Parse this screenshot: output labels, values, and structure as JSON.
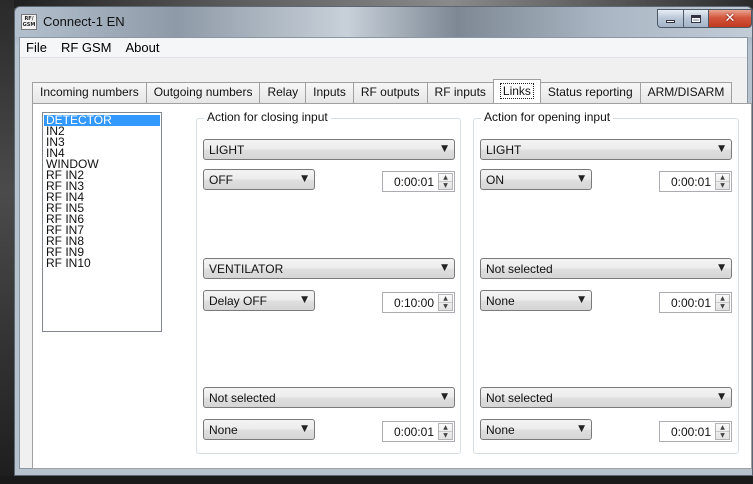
{
  "window": {
    "title": "Connect-1 EN",
    "icon_text": "RF/ GSM",
    "controls": {
      "minimize_icon": "minimize-icon",
      "maximize_icon": "maximize-icon",
      "close_icon": "close-icon",
      "close_glyph": "✕"
    }
  },
  "menu": [
    "File",
    "RF GSM",
    "About"
  ],
  "tabs": [
    {
      "label": "Incoming numbers"
    },
    {
      "label": "Outgoing numbers"
    },
    {
      "label": "Relay"
    },
    {
      "label": "Inputs"
    },
    {
      "label": "RF outputs"
    },
    {
      "label": "RF inputs"
    },
    {
      "label": "Links",
      "active": true
    },
    {
      "label": "Status reporting"
    },
    {
      "label": "ARM/DISARM"
    }
  ],
  "inputs_list": {
    "selected": "DETECTOR",
    "items": [
      "DETECTOR",
      "IN2",
      "IN3",
      "IN4",
      "WINDOW",
      "RF IN2",
      "RF IN3",
      "RF IN4",
      "RF IN5",
      "RF IN6",
      "RF IN7",
      "RF IN8",
      "RF IN9",
      "RF IN10"
    ]
  },
  "closing": {
    "title": "Action for closing input",
    "rows": [
      {
        "target": "LIGHT",
        "action": "OFF",
        "time": "0:00:01"
      },
      {
        "target": "VENTILATOR",
        "action": "Delay OFF",
        "time": "0:10:00"
      },
      {
        "target": "Not selected",
        "action": "None",
        "time": "0:00:01"
      }
    ]
  },
  "opening": {
    "title": "Action for opening input",
    "rows": [
      {
        "target": "LIGHT",
        "action": "ON",
        "time": "0:00:01"
      },
      {
        "target": "Not selected",
        "action": "None",
        "time": "0:00:01"
      },
      {
        "target": "Not selected",
        "action": "None",
        "time": "0:00:01"
      }
    ]
  },
  "glyphs": {
    "dropdown_arrow": "▼",
    "spin_up": "▲",
    "spin_down": "▼"
  },
  "colors": {
    "selection": "#3399ff",
    "close_button": "#c8452c"
  }
}
